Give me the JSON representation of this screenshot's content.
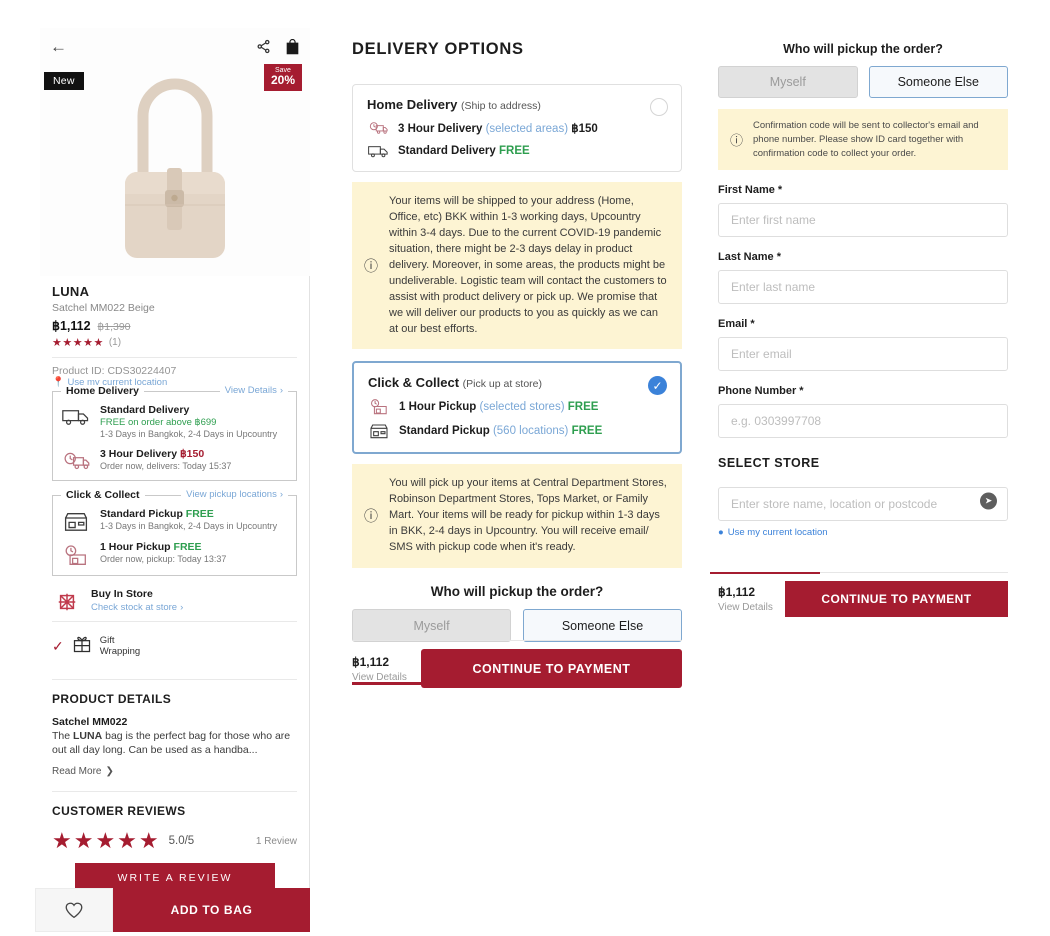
{
  "product": {
    "badge_new": "New",
    "badge_save_top": "Save",
    "badge_save_pct": "20%",
    "title": "LUNA",
    "subtitle": "Satchel MM022 Beige",
    "price": "฿1,112",
    "old_price": "฿1,390",
    "stars": "★★★★★",
    "review_count": "(1)",
    "product_id": "Product ID: CDS30224407",
    "use_location": "Use my current location"
  },
  "home_delivery_box": {
    "legend": "Home Delivery",
    "link": "View Details",
    "options": [
      {
        "title": "Standard Delivery",
        "free_note": "FREE on order above ฿699",
        "detail": "1-3 Days in Bangkok, 2-4 Days in Upcountry"
      },
      {
        "title": "3 Hour Delivery",
        "amount": "฿150",
        "detail": "Order now, delivers:  Today 15:37"
      }
    ]
  },
  "click_collect_box": {
    "legend": "Click & Collect",
    "link": "View pickup locations",
    "options": [
      {
        "title": "Standard Pickup",
        "free": "FREE",
        "detail": "1-3 Days in Bangkok, 2-4 Days in Upcountry"
      },
      {
        "title": "1 Hour Pickup",
        "free": "FREE",
        "detail": "Order now, pickup: Today 13:37"
      }
    ]
  },
  "buy_in_store": {
    "title": "Buy In Store",
    "link": "Check stock at store"
  },
  "gift": {
    "line1": "Gift",
    "line2": "Wrapping"
  },
  "product_details": {
    "heading": "PRODUCT DETAILS",
    "model": "Satchel MM022",
    "desc_pre": "The ",
    "desc_bold": "LUNA",
    "desc_post": " bag is the perfect bag for those who are out all day long. Can be used as a handba...",
    "read_more": "Read More"
  },
  "reviews": {
    "heading": "CUSTOMER REVIEWS",
    "stars": "★★★★★",
    "score": "5.0/5",
    "count": "1 Review",
    "write_review": "WRITE A REVIEW"
  },
  "bottom_bar": {
    "add_to_bag": "ADD TO BAG"
  },
  "middle": {
    "heading": "DELIVERY OPTIONS",
    "home_delivery": {
      "title": "Home Delivery",
      "subtitle": "(Ship to address)",
      "rows": [
        {
          "label": "3 Hour Delivery",
          "muted": "(selected areas)",
          "value": "฿150",
          "value_kind": "baht"
        },
        {
          "label": "Standard Delivery",
          "muted": "",
          "value": "FREE",
          "value_kind": "free"
        }
      ],
      "note": "Your items will be shipped to your address (Home, Office, etc) BKK within 1-3 working days, Upcountry within 3-4 days. Due to the current COVID-19 pandemic situation, there might be 2-3 days delay in product delivery. Moreover, in some areas, the products might be undeliverable. Logistic team will contact the customers to assist with product delivery or pick up. We promise that we will deliver our products to you as quickly as we can at our best efforts."
    },
    "click_collect": {
      "title": "Click & Collect",
      "subtitle": "(Pick up at store)",
      "rows": [
        {
          "label": "1 Hour Pickup",
          "muted": "(selected stores)",
          "value": "FREE",
          "value_kind": "free"
        },
        {
          "label": "Standard Pickup",
          "muted": "(560 locations)",
          "value": "FREE",
          "value_kind": "free"
        }
      ],
      "note": "You will pick up your items at Central Department Stores, Robinson Department Stores, Tops Market, or Family Mart. Your items will be ready for pickup within 1-3 days in BKK, 2-4 days in Upcountry. You will receive email/ SMS with pickup code when it's ready."
    },
    "pickup_question": "Who will pickup the order?",
    "seg_myself": "Myself",
    "seg_someone": "Someone Else",
    "footer_price": "฿1,112",
    "footer_details": "View Details",
    "footer_cta": "CONTINUE TO PAYMENT"
  },
  "right": {
    "pickup_question": "Who will pickup the order?",
    "seg_myself": "Myself",
    "seg_someone": "Someone Else",
    "note": "Confirmation code will be sent to collector's email and phone number. Please show ID card together with confirmation code to collect your order.",
    "fields": [
      {
        "label": "First Name *",
        "placeholder": "Enter first name",
        "value": ""
      },
      {
        "label": "Last Name *",
        "placeholder": "Enter last name",
        "value": ""
      },
      {
        "label": "Email *",
        "placeholder": "Enter email",
        "value": ""
      },
      {
        "label": "Phone Number *",
        "placeholder": "e.g. 0303997708",
        "value": ""
      }
    ],
    "select_store_heading": "SELECT STORE",
    "store_placeholder": "Enter store name, location or postcode",
    "use_location": "Use my current location",
    "footer_price": "฿1,112",
    "footer_details": "View Details",
    "footer_cta": "CONTINUE TO PAYMENT"
  },
  "colors": {
    "brand_red": "#a51c30",
    "note_yellow": "#fdf4d3",
    "link_blue": "#7aa7d6",
    "selected_blue": "#3b82d9",
    "free_green": "#2e9e4f"
  }
}
